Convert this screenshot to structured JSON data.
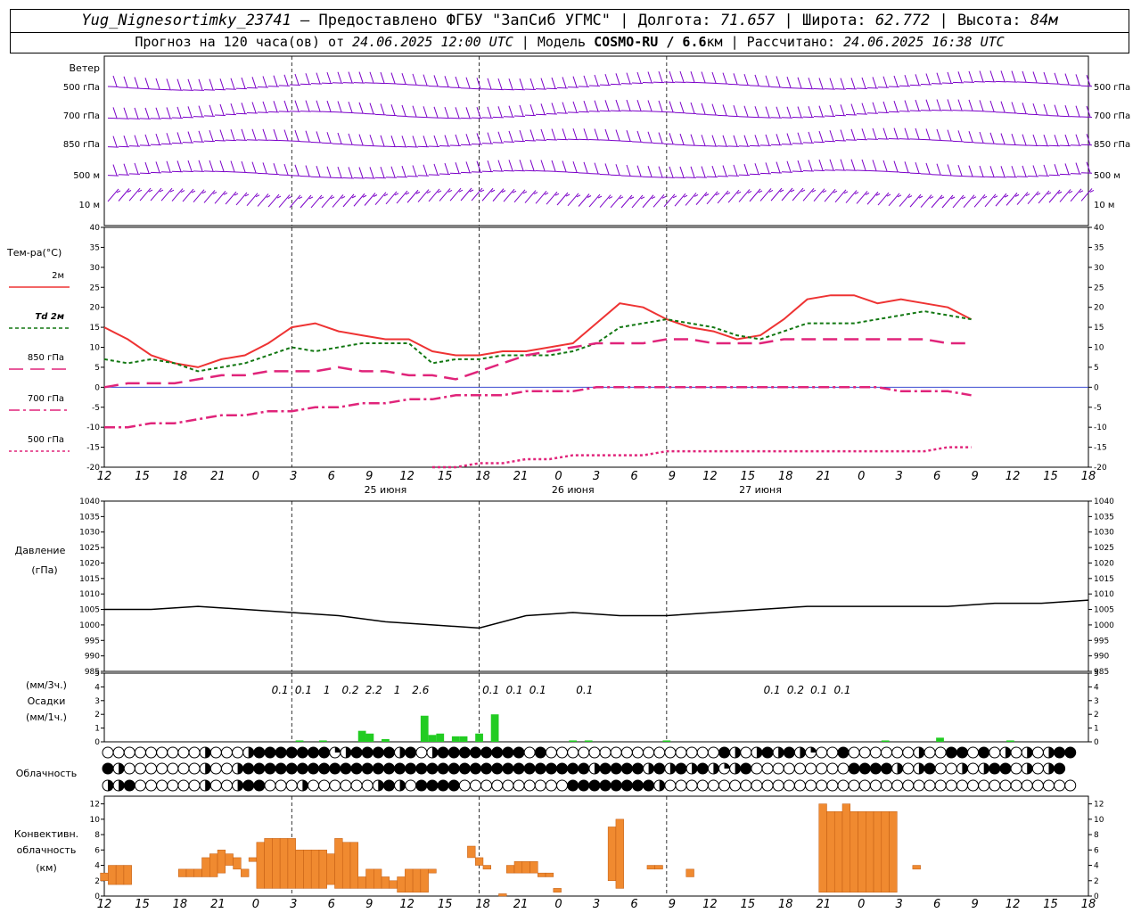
{
  "header": {
    "station": "Yug_Nignesortimky_23741",
    "provided": " — Предоставлено ФГБУ \"ЗапСиб УГМС\" | Долгота: ",
    "lon": "71.657",
    "lat_label": " | Широта: ",
    "lat": "62.772",
    "alt_label": " | Высота: ",
    "alt": "84м",
    "forecast_label": "Прогноз на 120 часа(ов) от ",
    "forecast_from": "24.06.2025 12:00 UTC",
    "model_label": " | Модель ",
    "model": "COSMO-RU / 6.6",
    "model_unit": "км",
    "calc_label": " | Рассчитано: ",
    "calc_time": "24.06.2025 16:38 UTC"
  },
  "wind_panel": {
    "title": "Ветер",
    "levels": [
      "500 гПа",
      "700 гПа",
      "850 гПа",
      "500 м",
      "10 м"
    ],
    "barb_color": "#7b00c8"
  },
  "hour_ticks": [
    "12",
    "15",
    "18",
    "21",
    "0",
    "3",
    "6",
    "9",
    "12",
    "15",
    "18",
    "21",
    "0",
    "3",
    "6",
    "9",
    "12",
    "15",
    "18",
    "21",
    "0",
    "3",
    "6",
    "9",
    "12",
    "15",
    "18"
  ],
  "day_labels": [
    "25 июня",
    "26 июня",
    "27 июня"
  ],
  "chart_data": [
    {
      "type": "line",
      "title": "Тем-ра(°C)",
      "ylim": [
        -20,
        40
      ],
      "yticks": [
        -20,
        -15,
        -10,
        -5,
        0,
        5,
        10,
        15,
        20,
        25,
        30,
        35,
        40
      ],
      "x_hours": [
        0,
        3,
        6,
        9,
        12,
        15,
        18,
        21,
        24,
        27,
        30,
        33,
        36,
        39,
        42,
        45,
        48,
        51,
        54,
        57,
        60,
        63,
        66,
        69,
        72,
        75,
        78,
        81,
        84,
        87,
        90,
        93,
        96,
        99,
        102,
        105,
        108,
        111,
        114,
        117,
        120,
        123,
        126
      ],
      "series": [
        {
          "name": "2м",
          "color": "#ee3333",
          "dash": "",
          "values": [
            15,
            12,
            8,
            6,
            5,
            7,
            8,
            11,
            15,
            16,
            14,
            13,
            12,
            12,
            9,
            8,
            8,
            9,
            9,
            10,
            11,
            16,
            21,
            20,
            17,
            15,
            14,
            12,
            13,
            17,
            22,
            23,
            23,
            21,
            22,
            21,
            20,
            17,
            null,
            null,
            null,
            null,
            null
          ]
        },
        {
          "name": "Td 2м",
          "color": "#117711",
          "dash": "4,3",
          "values": [
            7,
            6,
            7,
            6,
            4,
            5,
            6,
            8,
            10,
            9,
            10,
            11,
            11,
            11,
            6,
            7,
            7,
            8,
            8,
            8,
            9,
            11,
            15,
            16,
            17,
            16,
            15,
            13,
            12,
            14,
            16,
            16,
            16,
            17,
            18,
            19,
            18,
            17,
            null,
            null,
            null,
            null,
            null
          ]
        },
        {
          "name": "850 гПа",
          "color": "#e0247a",
          "dash": "16,8",
          "values": [
            0,
            1,
            1,
            1,
            2,
            3,
            3,
            4,
            4,
            4,
            5,
            4,
            4,
            3,
            3,
            2,
            4,
            6,
            8,
            9,
            10,
            11,
            11,
            11,
            12,
            12,
            11,
            11,
            11,
            12,
            12,
            12,
            12,
            12,
            12,
            12,
            11,
            11,
            null,
            null,
            null,
            null,
            null
          ]
        },
        {
          "name": "700 гПа",
          "color": "#e0247a",
          "dash": "12,4,3,4",
          "values": [
            -10,
            -10,
            -9,
            -9,
            -8,
            -7,
            -7,
            -6,
            -6,
            -5,
            -5,
            -4,
            -4,
            -3,
            -3,
            -2,
            -2,
            -2,
            -1,
            -1,
            -1,
            0,
            0,
            0,
            0,
            0,
            0,
            0,
            0,
            0,
            0,
            0,
            0,
            0,
            -1,
            -1,
            -1,
            -2,
            null,
            null,
            null,
            null,
            null
          ]
        },
        {
          "name": "500 гПа",
          "color": "#e0247a",
          "dash": "3,3",
          "values": [
            null,
            null,
            null,
            null,
            null,
            null,
            null,
            null,
            null,
            null,
            null,
            null,
            null,
            null,
            -20,
            -20,
            -19,
            -19,
            -18,
            -18,
            -17,
            -17,
            -17,
            -17,
            -16,
            -16,
            -16,
            -16,
            -16,
            -16,
            -16,
            -16,
            -16,
            -16,
            -16,
            -16,
            -15,
            -15,
            null,
            null,
            null,
            null,
            null
          ]
        }
      ]
    },
    {
      "type": "line",
      "title": "Давление",
      "ylabel": "(гПа)",
      "ylim": [
        985,
        1040
      ],
      "yticks": [
        985,
        990,
        995,
        1000,
        1005,
        1010,
        1015,
        1020,
        1025,
        1030,
        1035,
        1040
      ],
      "x_hours": [
        0,
        6,
        12,
        18,
        24,
        30,
        36,
        42,
        48,
        54,
        60,
        66,
        72,
        78,
        84,
        90,
        96,
        102,
        108,
        114,
        120,
        126
      ],
      "series": [
        {
          "name": "Давление",
          "color": "#000000",
          "values": [
            1005,
            1005,
            1006,
            1005,
            1004,
            1003,
            1001,
            1000,
            999,
            1003,
            1004,
            1003,
            1003,
            1004,
            1005,
            1006,
            1006,
            1006,
            1006,
            1007,
            1007,
            1008
          ]
        }
      ]
    },
    {
      "type": "bar",
      "title": "Осадки",
      "ylabel": "(мм/3ч.)",
      "ylabel2": "(мм/1ч.)",
      "ylim": [
        0,
        5
      ],
      "yticks": [
        0,
        1,
        2,
        3,
        4,
        5
      ],
      "color": "#22cc22",
      "hourly": [
        {
          "h": 25,
          "v": 0.1
        },
        {
          "h": 28,
          "v": 0.1
        },
        {
          "h": 33,
          "v": 0.8
        },
        {
          "h": 34,
          "v": 0.6
        },
        {
          "h": 36,
          "v": 0.2
        },
        {
          "h": 41,
          "v": 1.9
        },
        {
          "h": 42,
          "v": 0.5
        },
        {
          "h": 43,
          "v": 0.6
        },
        {
          "h": 45,
          "v": 0.4
        },
        {
          "h": 46,
          "v": 0.4
        },
        {
          "h": 48,
          "v": 0.6
        },
        {
          "h": 50,
          "v": 2.0
        },
        {
          "h": 60,
          "v": 0.1
        },
        {
          "h": 62,
          "v": 0.1
        },
        {
          "h": 72,
          "v": 0.1
        },
        {
          "h": 100,
          "v": 0.1
        },
        {
          "h": 107,
          "v": 0.3
        },
        {
          "h": 116,
          "v": 0.1
        }
      ],
      "labels3h": [
        {
          "h": 22.5,
          "t": "0.1"
        },
        {
          "h": 25.5,
          "t": "0.1"
        },
        {
          "h": 28.5,
          "t": "1"
        },
        {
          "h": 31.5,
          "t": "0.2"
        },
        {
          "h": 34.5,
          "t": "2.2"
        },
        {
          "h": 37.5,
          "t": "1"
        },
        {
          "h": 40.5,
          "t": "2.6"
        },
        {
          "h": 49.5,
          "t": "0.1"
        },
        {
          "h": 52.5,
          "t": "0.1"
        },
        {
          "h": 55.5,
          "t": "0.1"
        },
        {
          "h": 61.5,
          "t": "0.1"
        },
        {
          "h": 85.5,
          "t": "0.1"
        },
        {
          "h": 88.5,
          "t": "0.2"
        },
        {
          "h": 91.5,
          "t": "0.1"
        },
        {
          "h": 94.5,
          "t": "0.1"
        }
      ]
    },
    {
      "type": "bar",
      "title": "Конвективн. облачность",
      "ylabel": "(км)",
      "ylim": [
        0,
        13
      ],
      "yticks": [
        0,
        2,
        4,
        6,
        8,
        10,
        12
      ],
      "color": "#f08a30",
      "bars": [
        {
          "h": 0,
          "lo": 2,
          "hi": 3
        },
        {
          "h": 1,
          "lo": 1.5,
          "hi": 4
        },
        {
          "h": 2,
          "lo": 1.5,
          "hi": 4
        },
        {
          "h": 3,
          "lo": 1.5,
          "hi": 4
        },
        {
          "h": 10,
          "lo": 2.5,
          "hi": 3.5
        },
        {
          "h": 11,
          "lo": 2.5,
          "hi": 3.5
        },
        {
          "h": 12,
          "lo": 2.5,
          "hi": 3.5
        },
        {
          "h": 13,
          "lo": 2.5,
          "hi": 5
        },
        {
          "h": 14,
          "lo": 2.5,
          "hi": 5.5
        },
        {
          "h": 15,
          "lo": 3,
          "hi": 6
        },
        {
          "h": 16,
          "lo": 4,
          "hi": 5.5
        },
        {
          "h": 17,
          "lo": 3.5,
          "hi": 5
        },
        {
          "h": 18,
          "lo": 2.5,
          "hi": 3.5
        },
        {
          "h": 19,
          "lo": 4.5,
          "hi": 5
        },
        {
          "h": 20,
          "lo": 1,
          "hi": 7
        },
        {
          "h": 21,
          "lo": 1,
          "hi": 7.5
        },
        {
          "h": 22,
          "lo": 1,
          "hi": 7.5
        },
        {
          "h": 23,
          "lo": 1,
          "hi": 7.5
        },
        {
          "h": 24,
          "lo": 1,
          "hi": 7.5
        },
        {
          "h": 25,
          "lo": 1,
          "hi": 6
        },
        {
          "h": 26,
          "lo": 1,
          "hi": 6
        },
        {
          "h": 27,
          "lo": 1,
          "hi": 6
        },
        {
          "h": 28,
          "lo": 1,
          "hi": 6
        },
        {
          "h": 29,
          "lo": 1.5,
          "hi": 5.5
        },
        {
          "h": 30,
          "lo": 1,
          "hi": 7.5
        },
        {
          "h": 31,
          "lo": 1,
          "hi": 7
        },
        {
          "h": 32,
          "lo": 1,
          "hi": 7
        },
        {
          "h": 33,
          "lo": 1,
          "hi": 2.5
        },
        {
          "h": 34,
          "lo": 1,
          "hi": 3.5
        },
        {
          "h": 35,
          "lo": 1,
          "hi": 3.5
        },
        {
          "h": 36,
          "lo": 1,
          "hi": 2.5
        },
        {
          "h": 37,
          "lo": 1,
          "hi": 2
        },
        {
          "h": 38,
          "lo": 0.5,
          "hi": 2.5
        },
        {
          "h": 39,
          "lo": 0.5,
          "hi": 3.5
        },
        {
          "h": 40,
          "lo": 0.5,
          "hi": 3.5
        },
        {
          "h": 41,
          "lo": 0.5,
          "hi": 3.5
        },
        {
          "h": 42,
          "lo": 3,
          "hi": 3.5
        },
        {
          "h": 47,
          "lo": 5,
          "hi": 6.5
        },
        {
          "h": 48,
          "lo": 4,
          "hi": 5
        },
        {
          "h": 49,
          "lo": 3.5,
          "hi": 4
        },
        {
          "h": 51,
          "lo": 0,
          "hi": 0.3
        },
        {
          "h": 52,
          "lo": 3,
          "hi": 4
        },
        {
          "h": 53,
          "lo": 3,
          "hi": 4.5
        },
        {
          "h": 54,
          "lo": 3,
          "hi": 4.5
        },
        {
          "h": 55,
          "lo": 3,
          "hi": 4.5
        },
        {
          "h": 56,
          "lo": 2.5,
          "hi": 3
        },
        {
          "h": 57,
          "lo": 2.5,
          "hi": 3
        },
        {
          "h": 58,
          "lo": 0.5,
          "hi": 1
        },
        {
          "h": 65,
          "lo": 2,
          "hi": 9
        },
        {
          "h": 66,
          "lo": 1,
          "hi": 10
        },
        {
          "h": 70,
          "lo": 3.5,
          "hi": 4
        },
        {
          "h": 71,
          "lo": 3.5,
          "hi": 4
        },
        {
          "h": 75,
          "lo": 2.5,
          "hi": 3.5
        },
        {
          "h": 92,
          "lo": 0.5,
          "hi": 12
        },
        {
          "h": 93,
          "lo": 0.5,
          "hi": 11
        },
        {
          "h": 94,
          "lo": 0.5,
          "hi": 11
        },
        {
          "h": 95,
          "lo": 0.5,
          "hi": 12
        },
        {
          "h": 96,
          "lo": 0.5,
          "hi": 11
        },
        {
          "h": 97,
          "lo": 0.5,
          "hi": 11
        },
        {
          "h": 98,
          "lo": 0.5,
          "hi": 11
        },
        {
          "h": 99,
          "lo": 0.5,
          "hi": 11
        },
        {
          "h": 100,
          "lo": 0.5,
          "hi": 11
        },
        {
          "h": 101,
          "lo": 0.5,
          "hi": 11
        },
        {
          "h": 104,
          "lo": 3.5,
          "hi": 4
        }
      ]
    }
  ],
  "clouds": {
    "title": "Облачность",
    "rows": [
      "OOOOOOOOOHOOOHDDDDDDDQHDDDDHDOHDDDDDDDDODOOOOOOOOOOOOOOOODHOHDHDHQOODOOOOOOHOODDODOHOHOHDD",
      "DHOOOOOOOHOOHDDDDDDDDDDDDDDDDDDDDDDDDDDDDDDDDHDDDDHDHDHDHQHDOOOOOOOOODDDDHOHDOOHOHDDOHOHD",
      "HHDOOOOOOHOOHDDOOOHOOOOOOHDHODDDDOOOOOOOOOODDDDDDDDHOOOOOOOOOOOOOOOOOOOOOOOOOOOOOOOOOOOOOO"
    ]
  }
}
